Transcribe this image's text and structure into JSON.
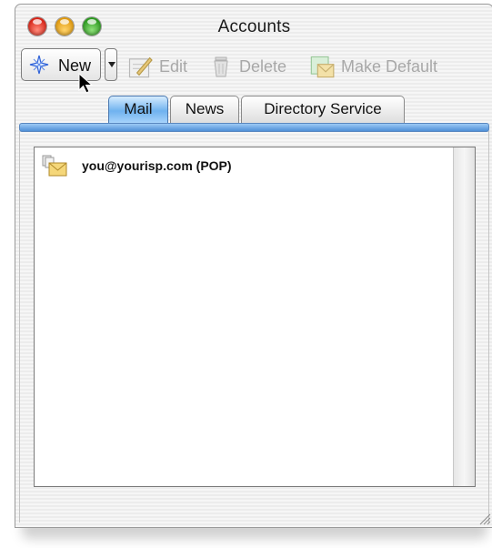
{
  "window": {
    "title": "Accounts"
  },
  "toolbar": {
    "new_label": "New",
    "edit_label": "Edit",
    "delete_label": "Delete",
    "default_label": "Make Default"
  },
  "tabs": [
    {
      "label": "Mail",
      "active": true
    },
    {
      "label": "News",
      "active": false
    },
    {
      "label": "Directory Service",
      "active": false
    }
  ],
  "accounts": [
    {
      "name": "you@yourisp.com (POP)",
      "icon": "mail-account-icon"
    }
  ],
  "colors": {
    "accent": "#6fb2ef",
    "close": "#d8261a",
    "minimize": "#e09a10",
    "zoom": "#2e9a22"
  }
}
